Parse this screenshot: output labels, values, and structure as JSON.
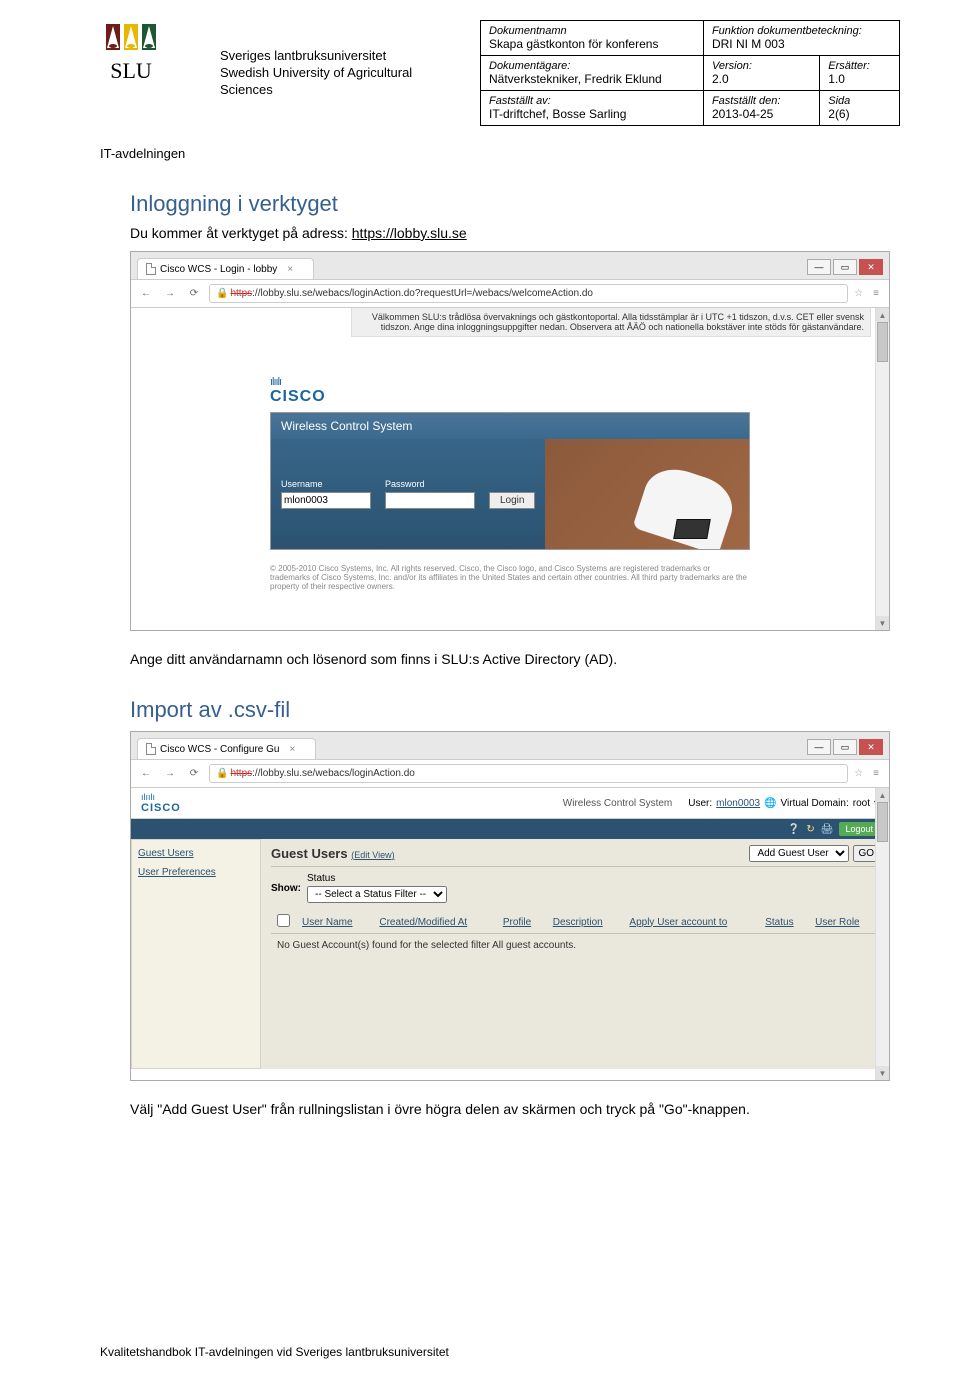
{
  "header": {
    "uni_line_1": "Sveriges lantbruksuniversitet",
    "uni_line_2": "Swedish University of Agricultural Sciences",
    "dept": "IT-avdelningen",
    "slu_text": "SLU"
  },
  "doc": {
    "dokumentnamn_label": "Dokumentnamn",
    "dokumentnamn": "Skapa gästkonton för konferens",
    "funktion_label": "Funktion dokumentbeteckning:",
    "funktion": "DRI NI M 003",
    "agare_label": "Dokumentägare:",
    "agare": "Nätverkstekniker, Fredrik Eklund",
    "version_label": "Version:",
    "version": "2.0",
    "ersatter_label": "Ersätter:",
    "ersatter": "1.0",
    "faststallt_av_label": "Fastställt av:",
    "faststallt_av": "IT-driftchef, Bosse Sarling",
    "faststallt_den_label": "Fastställt den:",
    "faststallt_den": "2013-04-25",
    "sida_label": "Sida",
    "sida": "2(6)"
  },
  "sections": {
    "login_heading": "Inloggning i verktyget",
    "login_text_pre": "Du kommer åt verktyget på adress: ",
    "login_link": "https://lobby.slu.se",
    "login_caption": "Ange ditt användarnamn och lösenord som finns i SLU:s Active Directory (AD).",
    "import_heading": "Import av .csv-fil",
    "import_caption": "Välj \"Add Guest User\" från rullningslistan i övre högra delen av skärmen och tryck på \"Go\"-knappen."
  },
  "ss1": {
    "tab_title": "Cisco WCS - Login - lobby",
    "url_prefix": "https",
    "url_rest": "://lobby.slu.se/webacs/loginAction.do?requestUrl=/webacs/welcomeAction.do",
    "welcome": "Välkommen SLU:s trådlösa övervaknings och gästkontoportal. Alla tidsstämplar är i UTC +1 tidszon, d.v.s. CET eller svensk tidszon. Ange dina inloggningsuppgifter nedan. Observera att ÅÄÖ och nationella bokstäver inte stöds för gästanvändare.",
    "cisco_bars": "ılıılı",
    "cisco_word": "CISCO",
    "panel_title": "Wireless Control System",
    "username_label": "Username",
    "password_label": "Password",
    "username_value": "mlon0003",
    "login_btn": "Login",
    "copyright": "© 2005-2010 Cisco Systems, Inc. All rights reserved. Cisco, the Cisco logo, and Cisco Systems are registered trademarks or trademarks of Cisco Systems, Inc. and/or its affiliates in the United States and certain other countries. All third party trademarks are the property of their respective owners."
  },
  "ss2": {
    "tab_title": "Cisco WCS - Configure Gu",
    "url_prefix": "https",
    "url_rest": "://lobby.slu.se/webacs/loginAction.do",
    "wcs_title": "Wireless Control System",
    "user_label": "User:",
    "user_value": "mlon0003",
    "domain_label": "Virtual Domain:",
    "domain_value": "root",
    "logout": "Logout",
    "sidebar": {
      "guest_users": "Guest Users",
      "user_prefs": "User Preferences"
    },
    "gu_title": "Guest Users",
    "edit_view": "Edit View",
    "action_options": [
      "Add Guest User"
    ],
    "go_btn": "GO",
    "show_label": "Show:",
    "status_label": "Status",
    "filter_option": "-- Select a Status Filter --",
    "columns": [
      "",
      "User Name",
      "Created/Modified At",
      "Profile",
      "Description",
      "Apply User account to",
      "Status",
      "User Role"
    ],
    "empty_msg": "No Guest Account(s) found for the selected filter All guest accounts."
  },
  "footer": "Kvalitetshandbok IT-avdelningen vid Sveriges lantbruksuniversitet"
}
